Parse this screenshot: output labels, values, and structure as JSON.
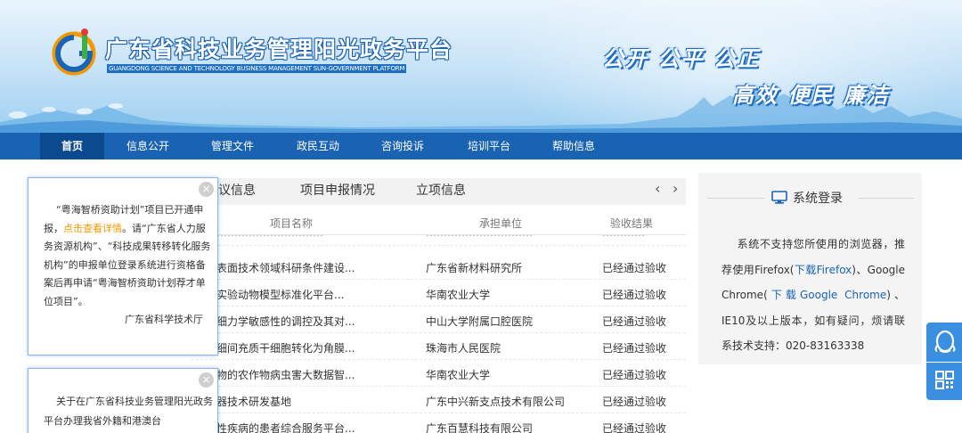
{
  "header": {
    "title": "广东省科技业务管理阳光政务平台",
    "subtitle": "GUANGDONG SCIENCE AND TECHNOLOGY BUSINESS MANAGEMENT SUN-GOVERNMENT PLATFORM",
    "slogan_line1": "公开 公平 公正",
    "slogan_line2": "高效 便民 廉洁"
  },
  "nav": {
    "items": [
      {
        "label": "首页"
      },
      {
        "label": "信息公开"
      },
      {
        "label": "管理文件"
      },
      {
        "label": "政民互动"
      },
      {
        "label": "咨询投诉"
      },
      {
        "label": "培训平台"
      },
      {
        "label": "帮助信息"
      }
    ]
  },
  "tabs": {
    "items": [
      {
        "label": "议信息"
      },
      {
        "label": "项目申报情况"
      },
      {
        "label": "立项信息"
      }
    ],
    "prev": "‹",
    "next": "›"
  },
  "table": {
    "headers": [
      "项目名称",
      "承担单位",
      "验收结果"
    ],
    "rows": [
      {
        "name": "…………………………",
        "unit": "…………………………",
        "result": "…………"
      },
      {
        "name": "表面技术领域科研条件建设...",
        "unit": "广东省新材料研究所",
        "result": "已经通过验收"
      },
      {
        "name": "实验动物模型标准化平台...",
        "unit": "华南农业大学",
        "result": "已经通过验收"
      },
      {
        "name": "细力学敏感性的调控及其对...",
        "unit": "中山大学附属口腔医院",
        "result": "已经通过验收"
      },
      {
        "name": "细间充质干细胞转化为角膜...",
        "unit": "珠海市人民医院",
        "result": "已经通过验收"
      },
      {
        "name": "物的农作物病虫害大数据智...",
        "unit": "华南农业大学",
        "result": "已经通过验收"
      },
      {
        "name": "器技术研发基地",
        "unit": "广东中兴新支点技术有限公司",
        "result": "已经通过验收"
      },
      {
        "name": "性疾病的患者综合服务平台...",
        "unit": "广东百慧科技有限公司",
        "result": "已经通过验收"
      }
    ]
  },
  "popup1": {
    "text_before": "“粤海智桥资助计划”项目已开通申报，",
    "link": "点击查看详情",
    "text_after": "。请“广东省人力服务资源机构”、“科技成果转移转化服务机构”的申报单位登录系统进行资格备案后再申请“粤海智桥资助计划荐才单位项目”。",
    "signature": "广东省科学技术厅",
    "close": "×"
  },
  "popup2": {
    "text": "关于在广东省科技业务管理阳光政务平台办理我省外籍和港澳台",
    "close": "×"
  },
  "login": {
    "title": "系统登录",
    "text1": "系统不支持您所使用的浏览器，推荐使用Firefox(",
    "link1": "下载Firefox",
    "text2": ")、Google Chrome(",
    "link2": "下载Google Chrome",
    "text3": ")、IE10及以上版本，如有疑问，烦请联系技术支持：020-83163338"
  },
  "colors": {
    "nav_bg": "#1a63b3",
    "nav_active": "#0c4a90",
    "link_orange": "#f39800",
    "link_blue": "#1a63b3",
    "side_btn": "#3a8fe0"
  }
}
